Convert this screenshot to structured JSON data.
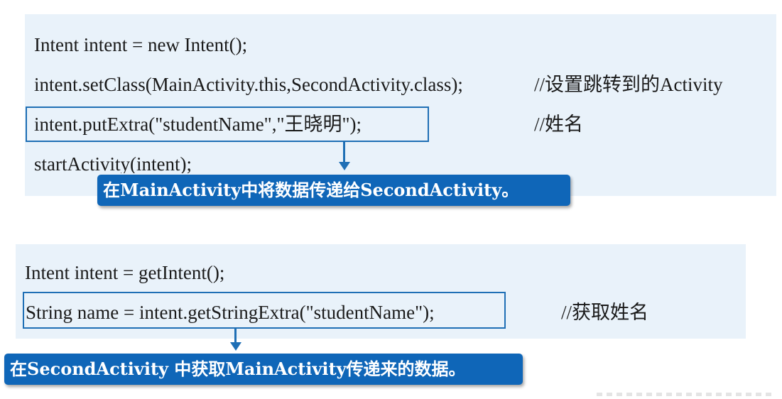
{
  "block1": {
    "lines": [
      "Intent intent = new Intent();",
      "intent.setClass(MainActivity.this,SecondActivity.class);",
      "intent.putExtra(\"studentName\",\"王晓明\");",
      "startActivity(intent);"
    ],
    "comments": {
      "set_class": "//设置跳转到的Activity",
      "put_extra": "//姓名"
    },
    "callout": "在MainActivity中将数据传递给SecondActivity。"
  },
  "block2": {
    "lines": [
      "Intent intent = getIntent();",
      "String name = intent.getStringExtra(\"studentName\");"
    ],
    "comments": {
      "get_extra": "//获取姓名"
    },
    "callout": "在SecondActivity 中获取MainActivity传递来的数据。"
  },
  "colors": {
    "panel_background": "#e9f2fa",
    "highlight_border": "#1f6fb5",
    "callout_background": "#0f66b8",
    "callout_text": "#ffffff"
  }
}
